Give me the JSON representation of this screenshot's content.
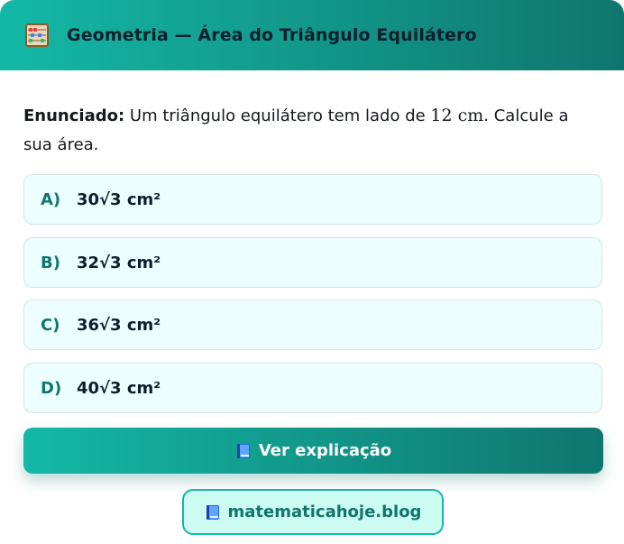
{
  "header": {
    "icon": "abacus-icon",
    "title": "Geometria — Área do Triângulo Equilátero"
  },
  "question": {
    "label": "Enunciado:",
    "text_before": " Um triângulo equilátero tem lado de ",
    "math": "12 cm",
    "text_after": ". Calcule a sua área."
  },
  "options": [
    {
      "letter": "A)",
      "text": "30√3 cm²"
    },
    {
      "letter": "B)",
      "text": "32√3 cm²"
    },
    {
      "letter": "C)",
      "text": "36√3 cm²"
    },
    {
      "letter": "D)",
      "text": "40√3 cm²"
    }
  ],
  "explain_button": {
    "icon": "book-icon",
    "label": "Ver explicação"
  },
  "blog_link": {
    "icon": "book-icon",
    "label": "matematicahoje.blog"
  },
  "colors": {
    "accent": "#14b8a6",
    "accent_dark": "#0f766e",
    "option_bg": "#ecfeff",
    "text_dark": "#0b1f2e"
  }
}
